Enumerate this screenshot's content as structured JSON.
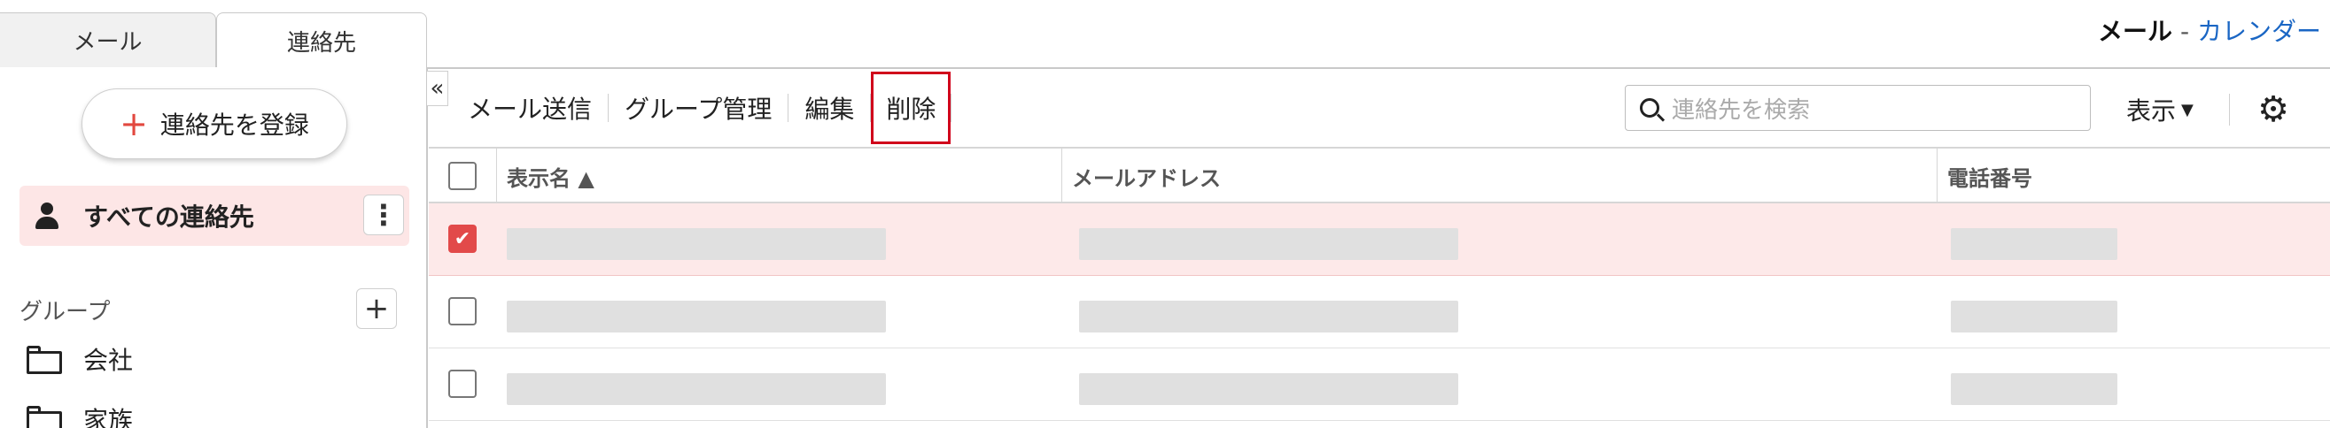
{
  "tabs": {
    "mail": "メール",
    "contacts": "連絡先"
  },
  "app_switcher": {
    "current": "メール",
    "separator": "-",
    "other": "カレンダー"
  },
  "sidebar": {
    "add_contact_label": "連絡先を登録",
    "all_contacts_label": "すべての連絡先",
    "kebab_label": "⋮",
    "group_section_label": "グループ",
    "group_add_label": "+",
    "groups": [
      {
        "label": "会社"
      },
      {
        "label": "家族"
      }
    ]
  },
  "collapse_label": "«",
  "toolbar": {
    "send_mail": "メール送信",
    "group_manage": "グループ管理",
    "edit": "編集",
    "delete": "削除",
    "search_placeholder": "連絡先を検索",
    "view_label": "表示",
    "view_caret": "▼"
  },
  "table": {
    "columns": {
      "name": "表示名 ▲",
      "email": "メールアドレス",
      "phone": "電話番号"
    },
    "rows": [
      {
        "checked": true
      },
      {
        "checked": false
      },
      {
        "checked": false
      }
    ]
  },
  "colors": {
    "accent": "#e24a4a",
    "selected_row": "#fde9e9",
    "highlight_box": "#d0021b",
    "link": "#1a66c4"
  }
}
